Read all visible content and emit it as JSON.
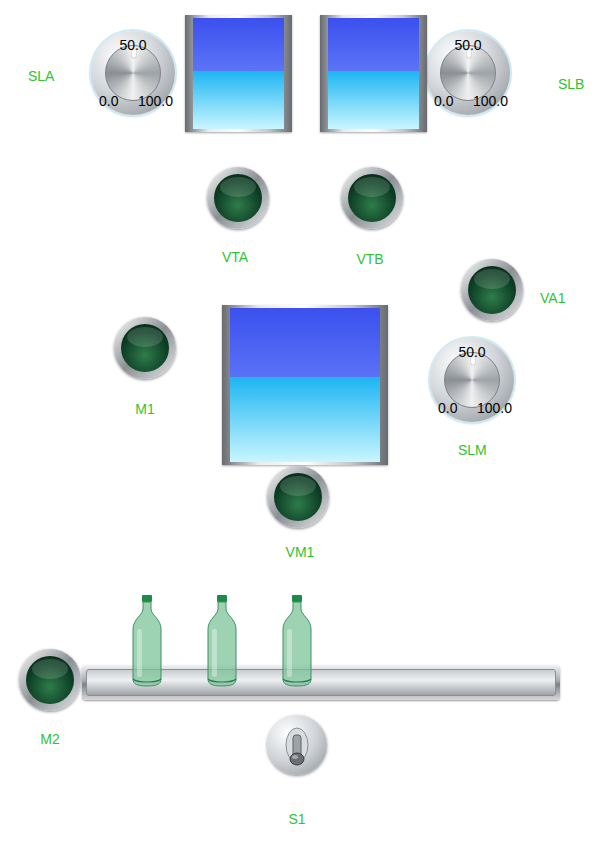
{
  "knobs": [
    {
      "label": "SLA",
      "scale": {
        "min": "0.0",
        "mid": "50.0",
        "max": "100.0"
      },
      "level": 0.5
    },
    {
      "label": "SLB",
      "scale": {
        "min": "0.0",
        "mid": "50.0",
        "max": "100.0"
      },
      "level": 0.5
    },
    {
      "label": "SLM",
      "scale": {
        "min": "0.0",
        "mid": "50.0",
        "max": "100.0"
      },
      "level": 0.5
    }
  ],
  "tanks": [
    {
      "level": 0.52
    },
    {
      "level": 0.52
    },
    {
      "level": 0.55
    }
  ],
  "lamps": [
    {
      "label": "VTA",
      "on": false
    },
    {
      "label": "VTB",
      "on": false
    },
    {
      "label": "VA1",
      "on": false
    },
    {
      "label": "M1",
      "on": false
    },
    {
      "label": "VM1",
      "on": false
    },
    {
      "label": "M2",
      "on": false
    }
  ],
  "conveyor": {
    "bottles": [
      {
        "present": true
      },
      {
        "present": true
      },
      {
        "present": true
      }
    ]
  },
  "switches": [
    {
      "label": "S1",
      "on": false
    }
  ]
}
